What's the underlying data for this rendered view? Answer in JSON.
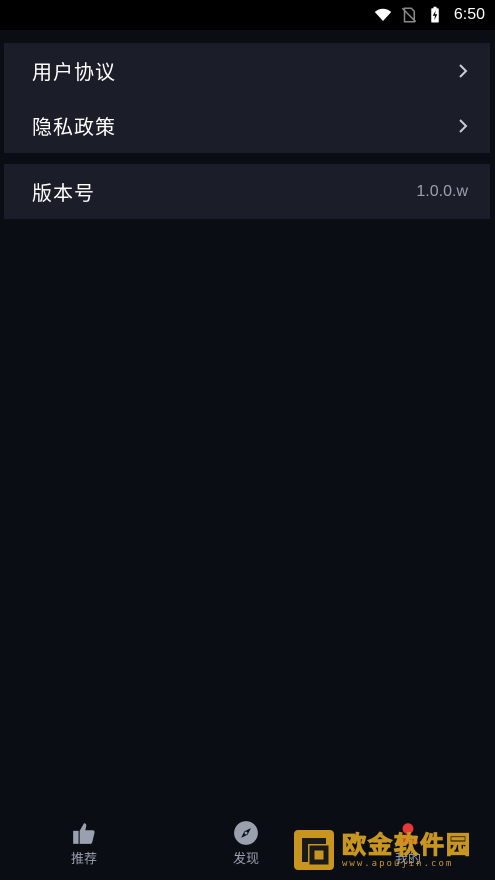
{
  "status_bar": {
    "time": "6:50",
    "icons": [
      "wifi-icon",
      "no-sim-icon",
      "battery-charging-icon"
    ]
  },
  "settings": {
    "group1": [
      {
        "label": "用户协议",
        "icon": "chevron-right-icon"
      },
      {
        "label": "隐私政策",
        "icon": "chevron-right-icon"
      }
    ],
    "group2": [
      {
        "label": "版本号",
        "value": "1.0.0.w"
      }
    ]
  },
  "tab_bar": {
    "items": [
      {
        "label": "推荐",
        "icon": "thumbs-up-icon"
      },
      {
        "label": "发现",
        "icon": "compass-icon"
      },
      {
        "label": "我的",
        "icon": "profile-icon"
      }
    ]
  },
  "watermark": {
    "text": "欧金软件园",
    "url": "www.apoujin.com"
  },
  "colors": {
    "background": "#0b0d14",
    "card": "#1b1d29",
    "secondary_text": "#9aa0ad",
    "watermark_gold": "#c8961e"
  }
}
